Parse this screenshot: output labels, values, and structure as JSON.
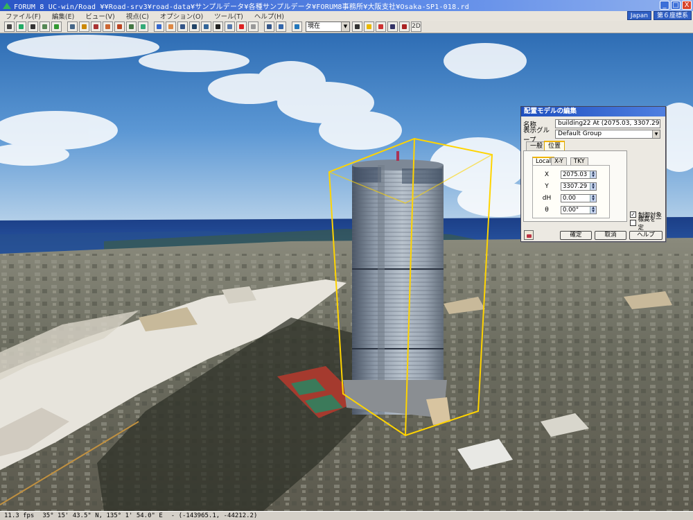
{
  "window": {
    "title": "FORUM 8   UC-win/Road   ¥¥Road-srv3¥road-data¥サンプルデータ¥各種サンプルデータ¥FORUM8事務所¥大阪支社¥Osaka-SP1-018.rd",
    "controls": [
      "_",
      "□",
      "X"
    ]
  },
  "menu": {
    "items": [
      "ファイル(F)",
      "編集(E)",
      "ビュー(V)",
      "視点(C)",
      "オプション(O)",
      "ツール(T)",
      "ヘルプ(H)"
    ],
    "locale": "Japan",
    "coord_system": "第６座標系"
  },
  "toolbar": {
    "time_select": "現在",
    "mode_2d": "2D"
  },
  "dialog": {
    "title": "配置モデルの編集",
    "name_label": "名称",
    "name_value": "building22 At (2075.03, 3307.29)",
    "group_label": "表示グループ",
    "group_value": "Default Group",
    "tabs": [
      "一般",
      "位置"
    ],
    "active_tab": "位置",
    "subtabs": [
      "Local",
      "X-Y",
      "TKY"
    ],
    "active_subtab": "Local",
    "fields": [
      {
        "label": "X",
        "value": "2075.03"
      },
      {
        "label": "Y",
        "value": "3307.29"
      },
      {
        "label": "dH",
        "value": "0.00"
      },
      {
        "label": "θ",
        "value": "0.00°"
      }
    ],
    "checkboxes": [
      {
        "label": "制御対象",
        "checked": true
      },
      {
        "label": "標高を一定",
        "checked": false
      }
    ],
    "buttons": {
      "ok": "確定",
      "cancel": "取消",
      "help": "ヘルプ"
    }
  },
  "status": {
    "fps": "11.3 fps",
    "latlon": "35°  15' 43.5\" N, 135°  1' 54.0\" E",
    "coords": "- (-143965.1, -44212.2)"
  }
}
